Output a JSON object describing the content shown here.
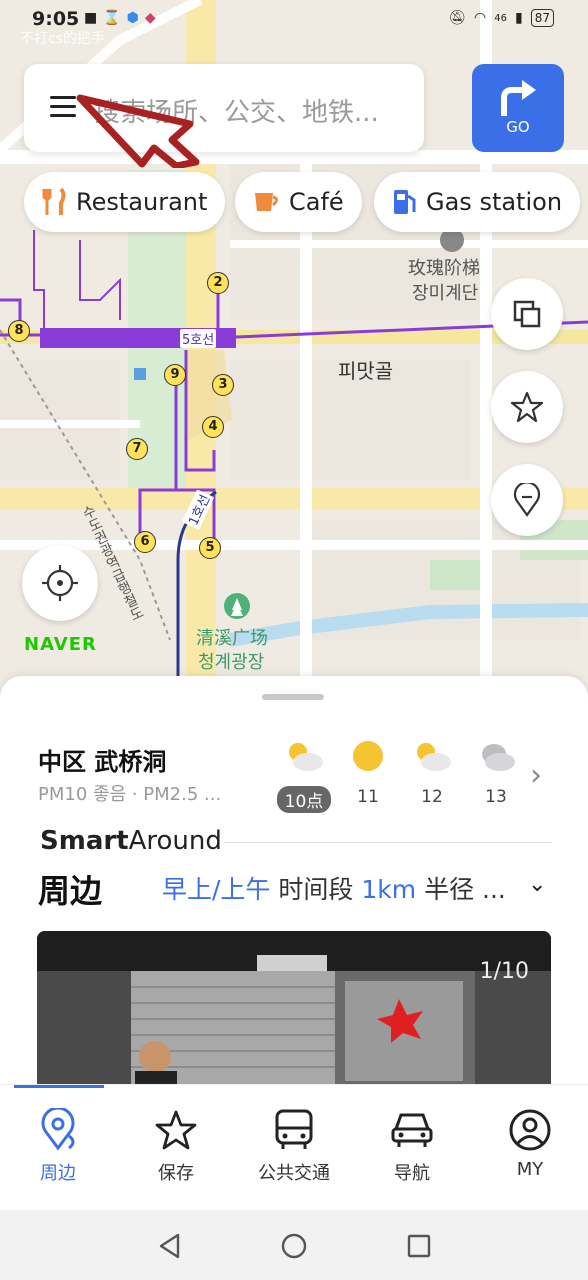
{
  "status_bar": {
    "time": "9:05",
    "ghost_text": "不打cs的把手",
    "network": "46",
    "battery": "87"
  },
  "search": {
    "placeholder": "搜索场所、公交、地铁...",
    "go_label": "GO"
  },
  "chips": [
    {
      "label": "Restaurant",
      "icon": "fork-knife-icon",
      "color": "#f08a3c"
    },
    {
      "label": "Café",
      "icon": "coffee-cup-icon",
      "color": "#f08a3c"
    },
    {
      "label": "Gas station",
      "icon": "fuel-pump-icon",
      "color": "#3a6fe8"
    }
  ],
  "map": {
    "labels": {
      "stairs_cn": "玫瑰阶梯",
      "stairs_kr": "장미계단",
      "pimatgol": "피맛골",
      "plaza_cn": "清溪广场",
      "plaza_kr": "청계광장",
      "line5": "5호선",
      "line1": "1호선",
      "station_kr": "수도권광역급행철도"
    },
    "exits": [
      "2",
      "8",
      "9",
      "3",
      "4",
      "7",
      "6",
      "5"
    ],
    "brand": "NAVER"
  },
  "sheet": {
    "place": "中区 武桥洞",
    "air": "PM10 좋음 · PM2.5 ...",
    "weather": [
      {
        "hour": "10点",
        "icon": "partly-cloudy-icon",
        "now": true
      },
      {
        "hour": "11",
        "icon": "sun-icon",
        "now": false
      },
      {
        "hour": "12",
        "icon": "partly-cloudy-icon",
        "now": false
      },
      {
        "hour": "13",
        "icon": "cloudy-icon",
        "now": false
      }
    ],
    "smart_bold": "Smart",
    "smart_rest": "Around",
    "nearby": "周边",
    "filter_time": "早上/上午",
    "filter_time_suffix": "时间段",
    "filter_radius": "1km",
    "filter_radius_suffix": "半径 ...",
    "photo_counter": "1/10"
  },
  "nav": {
    "items": [
      {
        "label": "周边",
        "icon": "nearby-pin-icon",
        "active": true
      },
      {
        "label": "保存",
        "icon": "star-icon",
        "active": false
      },
      {
        "label": "公共交通",
        "icon": "bus-icon",
        "active": false
      },
      {
        "label": "导航",
        "icon": "car-icon",
        "active": false
      },
      {
        "label": "MY",
        "icon": "user-icon",
        "active": false
      }
    ]
  },
  "colors": {
    "accent": "#3a6fe8",
    "line5": "#8a3cd8",
    "annotation_arrow": "#a82222"
  }
}
